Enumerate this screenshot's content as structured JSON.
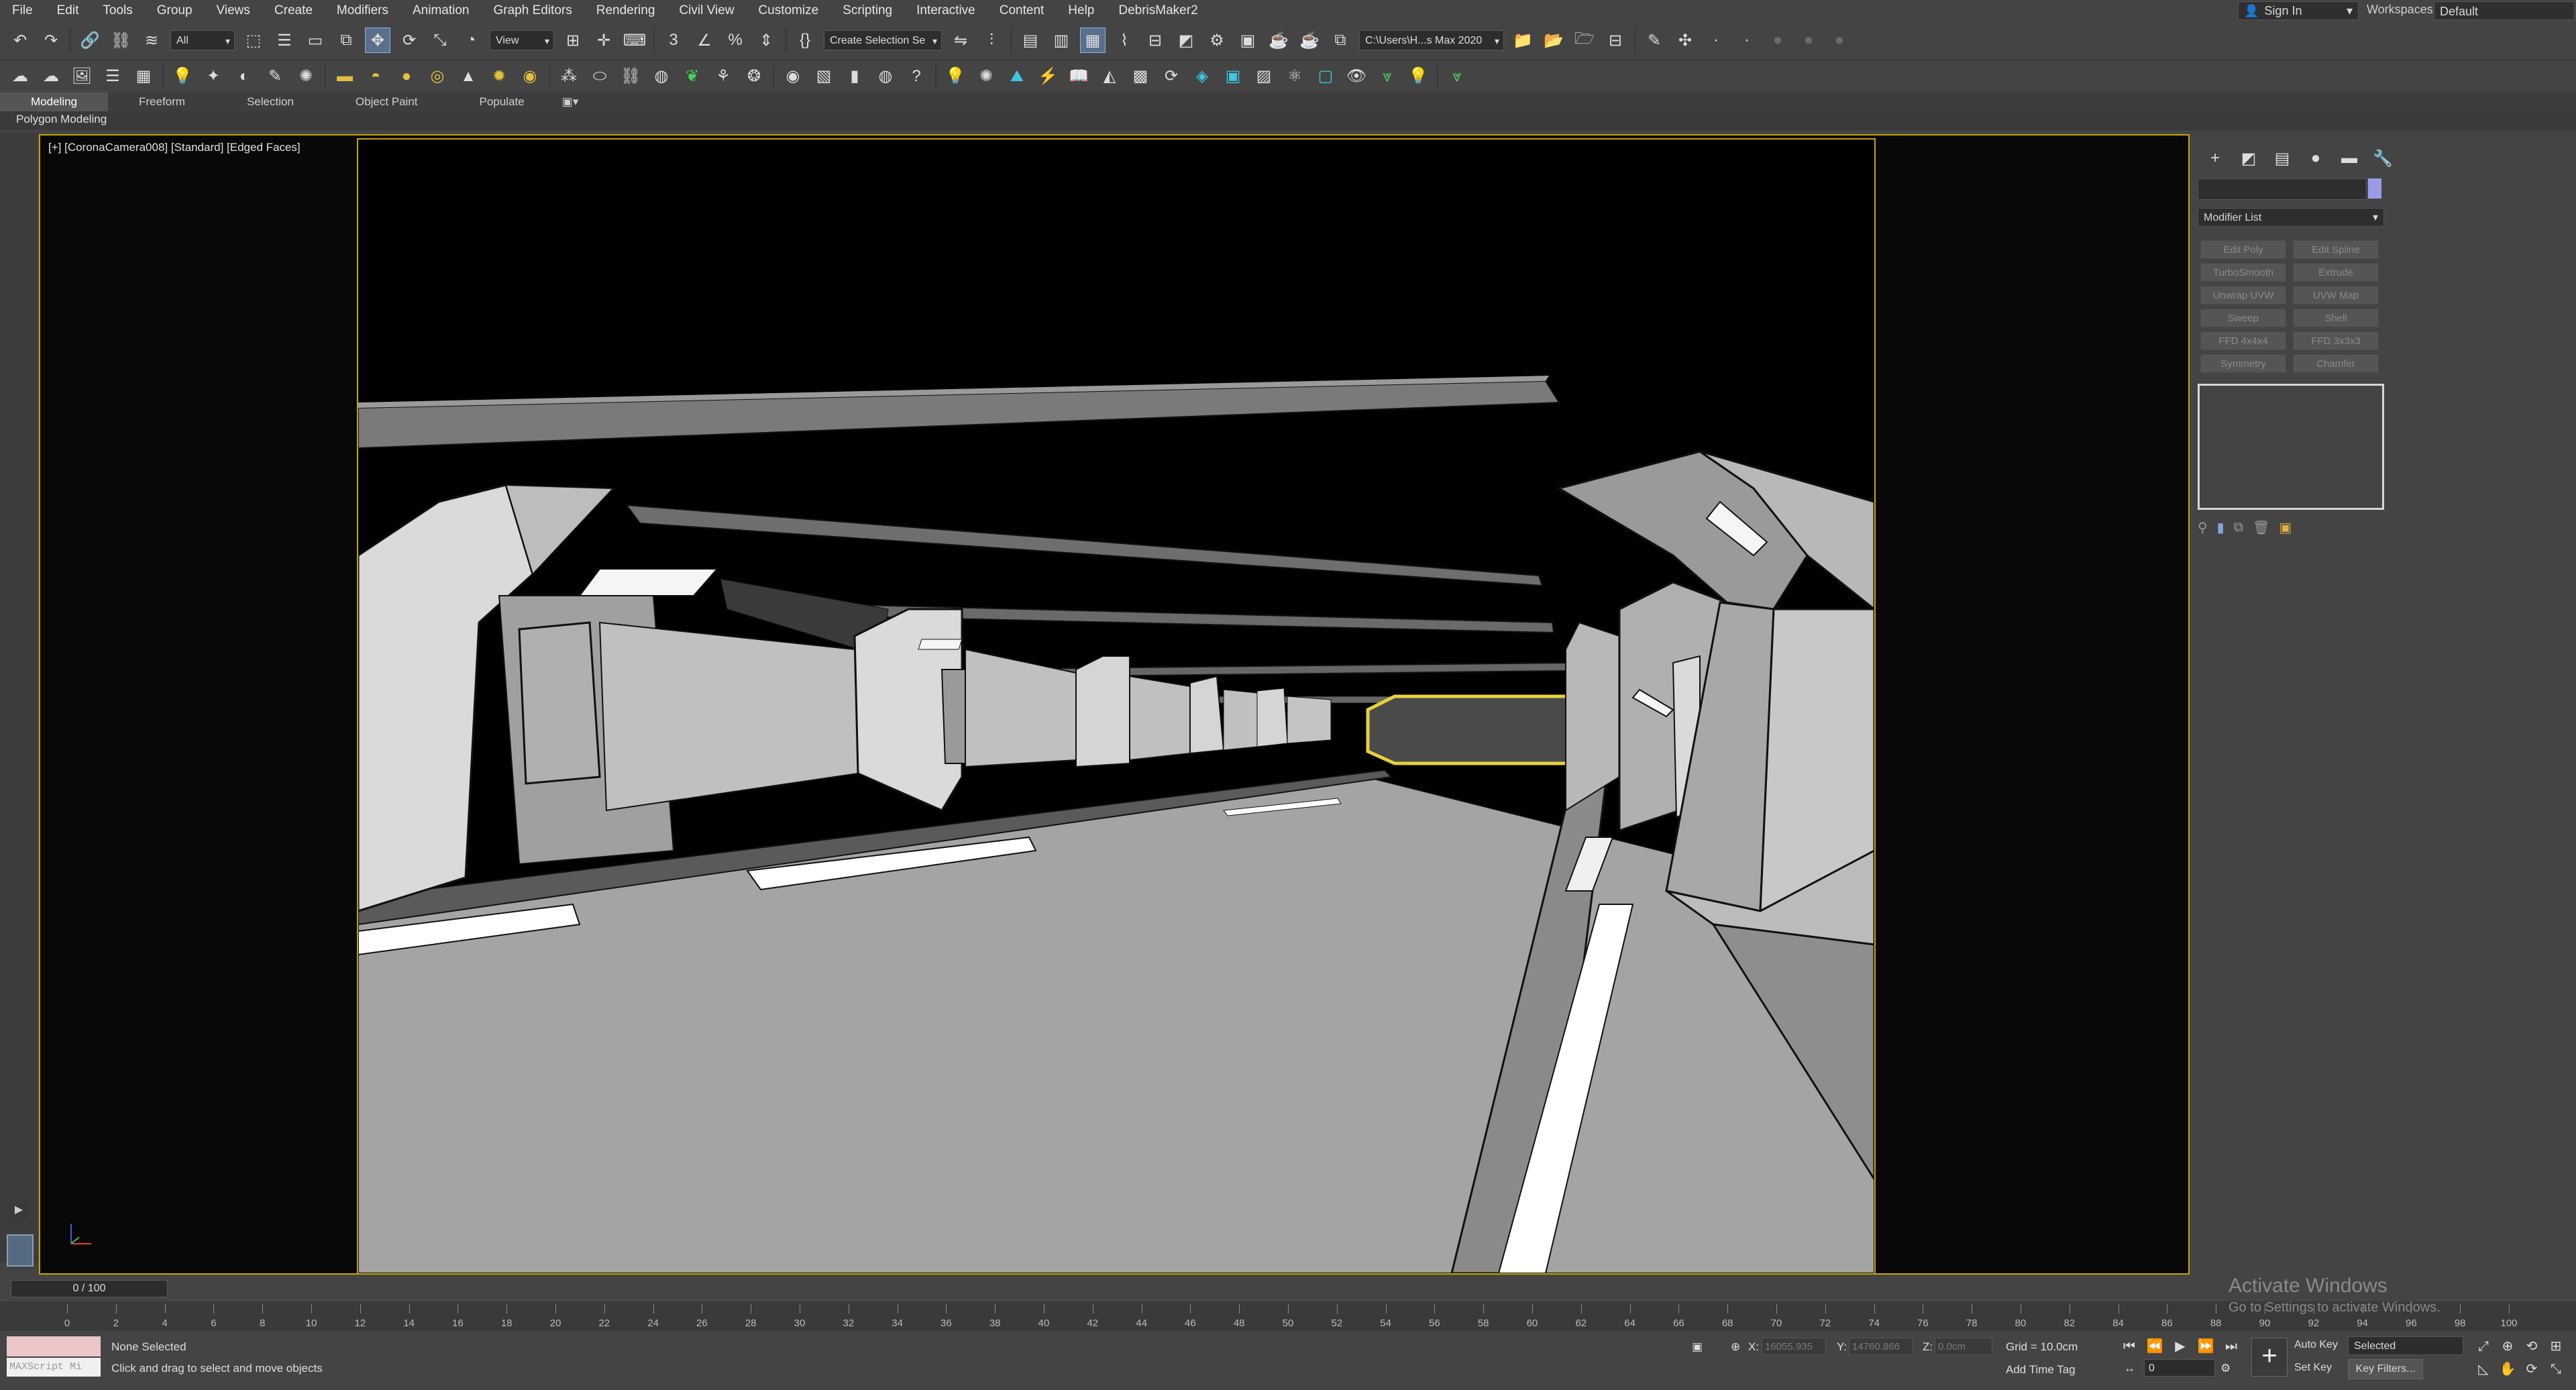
{
  "menu": [
    "File",
    "Edit",
    "Tools",
    "Group",
    "Views",
    "Create",
    "Modifiers",
    "Animation",
    "Graph Editors",
    "Rendering",
    "Civil View",
    "Customize",
    "Scripting",
    "Interactive",
    "Content",
    "Help",
    "DebrisMaker2"
  ],
  "account": {
    "sign_in": "Sign In",
    "workspaces_label": "Workspaces:",
    "workspace_value": "Default"
  },
  "toolbar": {
    "selection_filter": "All",
    "ref_coord": "View",
    "named_selection": "Create Selection Se",
    "project_path": "C:\\Users\\H...s Max 2020"
  },
  "ribbon": {
    "tabs": [
      "Modeling",
      "Freeform",
      "Selection",
      "Object Paint",
      "Populate"
    ],
    "panel_label": "Polygon Modeling"
  },
  "viewport": {
    "label": "[+] [CoronaCamera008] [Standard] [Edged Faces]"
  },
  "command_panel": {
    "modifier_list": "Modifier List",
    "modifier_buttons": [
      "Edit Poly",
      "Edit Spline",
      "TurboSmooth",
      "Extrude",
      "Unwrap UVW",
      "UVW Map",
      "Sweep",
      "Shell",
      "FFD 4x4x4",
      "FFD 3x3x3",
      "Symmetry",
      "Chamfer"
    ]
  },
  "timeline": {
    "slider": "0 / 100",
    "ticks": [
      "0",
      "2",
      "4",
      "6",
      "8",
      "10",
      "12",
      "14",
      "16",
      "18",
      "20",
      "22",
      "24",
      "26",
      "28",
      "30",
      "32",
      "34",
      "36",
      "38",
      "40",
      "42",
      "44",
      "46",
      "48",
      "50",
      "52",
      "54",
      "56",
      "58",
      "60",
      "62",
      "64",
      "66",
      "68",
      "70",
      "72",
      "74",
      "76",
      "78",
      "80",
      "82",
      "84",
      "86",
      "88",
      "90",
      "92",
      "94",
      "96",
      "98",
      "100"
    ]
  },
  "status": {
    "maxscript": "MAXScript Mi",
    "selection": "None Selected",
    "prompt": "Click and drag to select and move objects",
    "x_label": "X:",
    "x_value": "16055.935",
    "y_label": "Y:",
    "y_value": "14760.866",
    "z_label": "Z:",
    "z_value": "0.0cm",
    "grid": "Grid = 10.0cm",
    "add_time_tag": "Add Time Tag",
    "frame": "0",
    "auto_key": "Auto Key",
    "set_key": "Set Key",
    "selected": "Selected",
    "key_filters": "Key Filters..."
  },
  "watermark": {
    "line1": "Activate Windows",
    "line2": "Go to Settings to activate Windows."
  },
  "colors": {
    "frame_yellow": "#c8a400",
    "selection_yellow": "#e5d23a",
    "accent_cyan": "#3fc6e0",
    "accent_green": "#46d25a"
  }
}
